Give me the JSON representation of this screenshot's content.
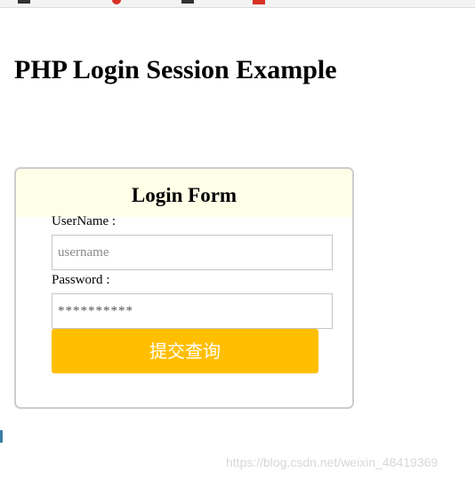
{
  "page": {
    "title": "PHP Login Session Example"
  },
  "login_form": {
    "title": "Login Form",
    "username_label": "UserName :",
    "username_placeholder": "username",
    "username_value": "",
    "password_label": "Password :",
    "password_value": "**********",
    "submit_label": "提交查询"
  },
  "watermark": "https://blog.csdn.net/weixin_48419369",
  "colors": {
    "header_background": "#ffffe8",
    "submit_background": "#ffbf00",
    "submit_text": "#ffffff",
    "card_border": "#cccccc"
  }
}
